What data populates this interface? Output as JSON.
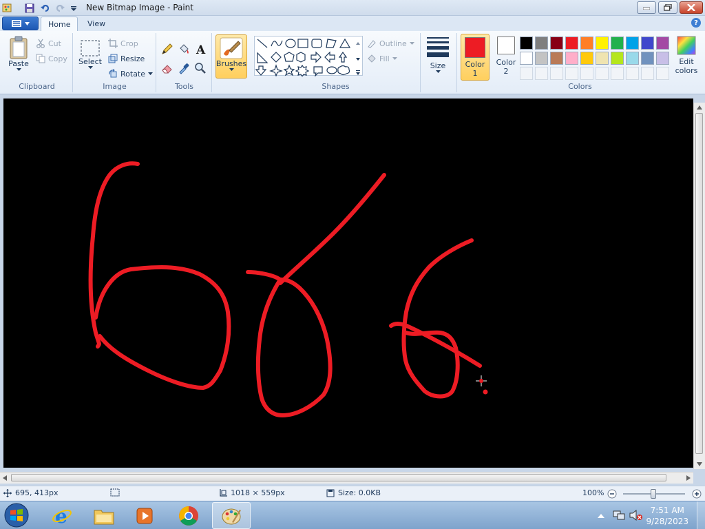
{
  "window": {
    "title": "New Bitmap Image - Paint"
  },
  "tabs": [
    {
      "label": "Home"
    },
    {
      "label": "View"
    }
  ],
  "ribbon": {
    "clipboard": {
      "group_label": "Clipboard",
      "paste": "Paste",
      "cut": "Cut",
      "copy": "Copy"
    },
    "image": {
      "group_label": "Image",
      "select": "Select",
      "crop": "Crop",
      "resize": "Resize",
      "rotate": "Rotate"
    },
    "tools": {
      "group_label": "Tools"
    },
    "brushes": {
      "label": "Brushes"
    },
    "shapes": {
      "group_label": "Shapes",
      "outline": "Outline",
      "fill": "Fill"
    },
    "size": {
      "label": "Size"
    },
    "colors": {
      "group_label": "Colors",
      "color1_line1": "Color",
      "color1_line2": "1",
      "color2_line1": "Color",
      "color2_line2": "2",
      "edit_colors_line1": "Edit",
      "edit_colors_line2": "colors",
      "color1_value": "#ed1c24",
      "color2_value": "#ffffff",
      "palette_row1": [
        "#000000",
        "#7f7f7f",
        "#880015",
        "#ed1c24",
        "#ff7f27",
        "#fff200",
        "#22b14c",
        "#00a2e8",
        "#3f48cc",
        "#a349a4"
      ],
      "palette_row2": [
        "#ffffff",
        "#c3c3c3",
        "#b97a57",
        "#ffaec9",
        "#ffc90e",
        "#efe4b0",
        "#b5e61d",
        "#99d9ea",
        "#7092be",
        "#c8bfe7"
      ]
    }
  },
  "canvas": {
    "background": "#000000",
    "stroke_color": "#ed1c24",
    "drawn_text": "666"
  },
  "status": {
    "cursor_position": "695, 413px",
    "canvas_dimensions": "1018 × 559px",
    "file_size": "Size: 0.0KB",
    "zoom": "100%"
  },
  "taskbar": {
    "time": "7:51 AM",
    "date": "9/28/2023"
  }
}
